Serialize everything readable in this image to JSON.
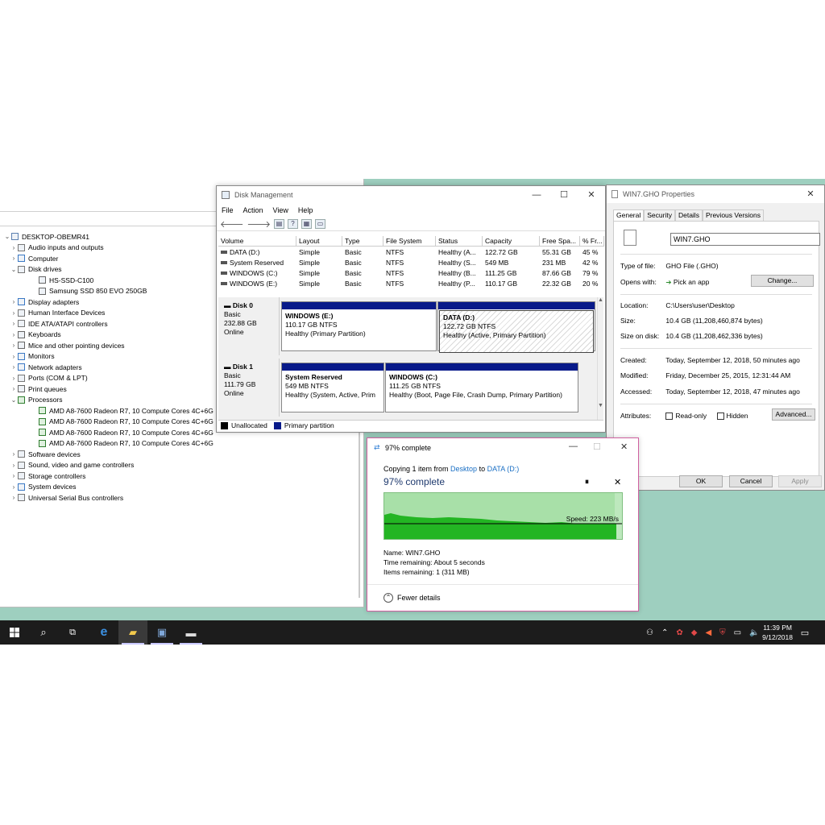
{
  "colors": {
    "primary_partition": "#081a8a",
    "unallocated": "#000000",
    "taskbar": "#1c1c1c",
    "copy_graph": "#23b523"
  },
  "device_manager": {
    "items": [
      {
        "chev": "⌄",
        "icon": "computer-icon",
        "label": "DESKTOP-OBEMR41",
        "indent": 0
      },
      {
        "chev": "›",
        "icon": "audio-icon",
        "label": "Audio inputs and outputs",
        "indent": 1
      },
      {
        "chev": "›",
        "icon": "monitor-icon",
        "label": "Computer",
        "indent": 1
      },
      {
        "chev": "⌄",
        "icon": "disk-icon",
        "label": "Disk drives",
        "indent": 1
      },
      {
        "chev": "",
        "icon": "drive-icon",
        "label": "HS-SSD-C100",
        "indent": 2
      },
      {
        "chev": "",
        "icon": "drive-icon",
        "label": "Samsung SSD 850 EVO 250GB",
        "indent": 2
      },
      {
        "chev": "›",
        "icon": "monitor-icon",
        "label": "Display adapters",
        "indent": 1
      },
      {
        "chev": "›",
        "icon": "hid-icon",
        "label": "Human Interface Devices",
        "indent": 1
      },
      {
        "chev": "›",
        "icon": "ide-icon",
        "label": "IDE ATA/ATAPI controllers",
        "indent": 1
      },
      {
        "chev": "›",
        "icon": "keyboard-icon",
        "label": "Keyboards",
        "indent": 1
      },
      {
        "chev": "›",
        "icon": "mouse-icon",
        "label": "Mice and other pointing devices",
        "indent": 1
      },
      {
        "chev": "›",
        "icon": "monitor-icon",
        "label": "Monitors",
        "indent": 1
      },
      {
        "chev": "›",
        "icon": "network-icon",
        "label": "Network adapters",
        "indent": 1
      },
      {
        "chev": "›",
        "icon": "port-icon",
        "label": "Ports (COM & LPT)",
        "indent": 1
      },
      {
        "chev": "›",
        "icon": "printer-icon",
        "label": "Print queues",
        "indent": 1
      },
      {
        "chev": "⌄",
        "icon": "processor-icon",
        "label": "Processors",
        "indent": 1
      },
      {
        "chev": "",
        "icon": "processor-icon",
        "label": "AMD A8-7600 Radeon R7, 10 Compute Cores 4C+6G",
        "indent": 2
      },
      {
        "chev": "",
        "icon": "processor-icon",
        "label": "AMD A8-7600 Radeon R7, 10 Compute Cores 4C+6G",
        "indent": 2
      },
      {
        "chev": "",
        "icon": "processor-icon",
        "label": "AMD A8-7600 Radeon R7, 10 Compute Cores 4C+6G",
        "indent": 2
      },
      {
        "chev": "",
        "icon": "processor-icon",
        "label": "AMD A8-7600 Radeon R7, 10 Compute Cores 4C+6G",
        "indent": 2
      },
      {
        "chev": "›",
        "icon": "software-icon",
        "label": "Software devices",
        "indent": 1
      },
      {
        "chev": "›",
        "icon": "sound-icon",
        "label": "Sound, video and game controllers",
        "indent": 1
      },
      {
        "chev": "›",
        "icon": "storage-icon",
        "label": "Storage controllers",
        "indent": 1
      },
      {
        "chev": "›",
        "icon": "system-icon",
        "label": "System devices",
        "indent": 1
      },
      {
        "chev": "›",
        "icon": "usb-icon",
        "label": "Universal Serial Bus controllers",
        "indent": 1
      }
    ]
  },
  "disk_management": {
    "title": "Disk Management",
    "menu": [
      "File",
      "Action",
      "View",
      "Help"
    ],
    "columns": [
      "Volume",
      "Layout",
      "Type",
      "File System",
      "Status",
      "Capacity",
      "Free Spa...",
      "% Fr..."
    ],
    "volumes": [
      [
        "DATA (D:)",
        "Simple",
        "Basic",
        "NTFS",
        "Healthy (A...",
        "122.72 GB",
        "55.31 GB",
        "45 %"
      ],
      [
        "System Reserved",
        "Simple",
        "Basic",
        "NTFS",
        "Healthy (S...",
        "549 MB",
        "231 MB",
        "42 %"
      ],
      [
        "WINDOWS (C:)",
        "Simple",
        "Basic",
        "NTFS",
        "Healthy (B...",
        "111.25 GB",
        "87.66 GB",
        "79 %"
      ],
      [
        "WINDOWS (E:)",
        "Simple",
        "Basic",
        "NTFS",
        "Healthy (P...",
        "110.17 GB",
        "22.32 GB",
        "20 %"
      ]
    ],
    "disks": [
      {
        "name": "Disk 0",
        "type": "Basic",
        "size": "232.88 GB",
        "state": "Online",
        "partitions": [
          {
            "name": "WINDOWS  (E:)",
            "size": "110.17 GB NTFS",
            "status": "Healthy (Primary Partition)"
          },
          {
            "name": "DATA  (D:)",
            "size": "122.72 GB NTFS",
            "status": "Healthy (Active, Primary Partition)"
          }
        ]
      },
      {
        "name": "Disk 1",
        "type": "Basic",
        "size": "111.79 GB",
        "state": "Online",
        "partitions": [
          {
            "name": "System Reserved",
            "size": "549 MB NTFS",
            "status": "Healthy (System, Active, Prim"
          },
          {
            "name": "WINDOWS  (C:)",
            "size": "111.25 GB NTFS",
            "status": "Healthy (Boot, Page File, Crash Dump, Primary Partition)"
          }
        ]
      }
    ],
    "legend": [
      "Unallocated",
      "Primary partition"
    ]
  },
  "properties": {
    "title": "WIN7.GHO Properties",
    "tabs": [
      "General",
      "Security",
      "Details",
      "Previous Versions"
    ],
    "file_name": "WIN7.GHO",
    "type_of_file_label": "Type of file:",
    "type_of_file": "GHO File (.GHO)",
    "opens_with_label": "Opens with:",
    "opens_with": "Pick an app",
    "change": "Change...",
    "location_label": "Location:",
    "location": "C:\\Users\\user\\Desktop",
    "size_label": "Size:",
    "size": "10.4 GB (11,208,460,874 bytes)",
    "size_on_disk_label": "Size on disk:",
    "size_on_disk": "10.4 GB (11,208,462,336 bytes)",
    "created_label": "Created:",
    "created": "Today, September 12, 2018, 50 minutes ago",
    "modified_label": "Modified:",
    "modified": "Friday, December 25, 2015, 12:31:44 AM",
    "accessed_label": "Accessed:",
    "accessed": "Today, September 12, 2018, 47 minutes ago",
    "attributes_label": "Attributes:",
    "read_only": "Read-only",
    "hidden": "Hidden",
    "advanced": "Advanced...",
    "ok": "OK",
    "cancel": "Cancel",
    "apply": "Apply"
  },
  "copy_dialog": {
    "title": "97% complete",
    "copying_prefix": "Copying 1 item from ",
    "from": "Desktop",
    "to_word": " to ",
    "to": "DATA (D:)",
    "heading": "97% complete",
    "progress": 0.97,
    "speed": "Speed: 223 MB/s",
    "name_label": "Name: ",
    "name": "WIN7.GHO",
    "time_label": "Time remaining: ",
    "time": "About 5 seconds",
    "items_label": "Items remaining: ",
    "items": "1 (311 MB)",
    "fewer_details": "Fewer details"
  },
  "taskbar": {
    "time": "11:39 PM",
    "date": "9/12/2018"
  }
}
